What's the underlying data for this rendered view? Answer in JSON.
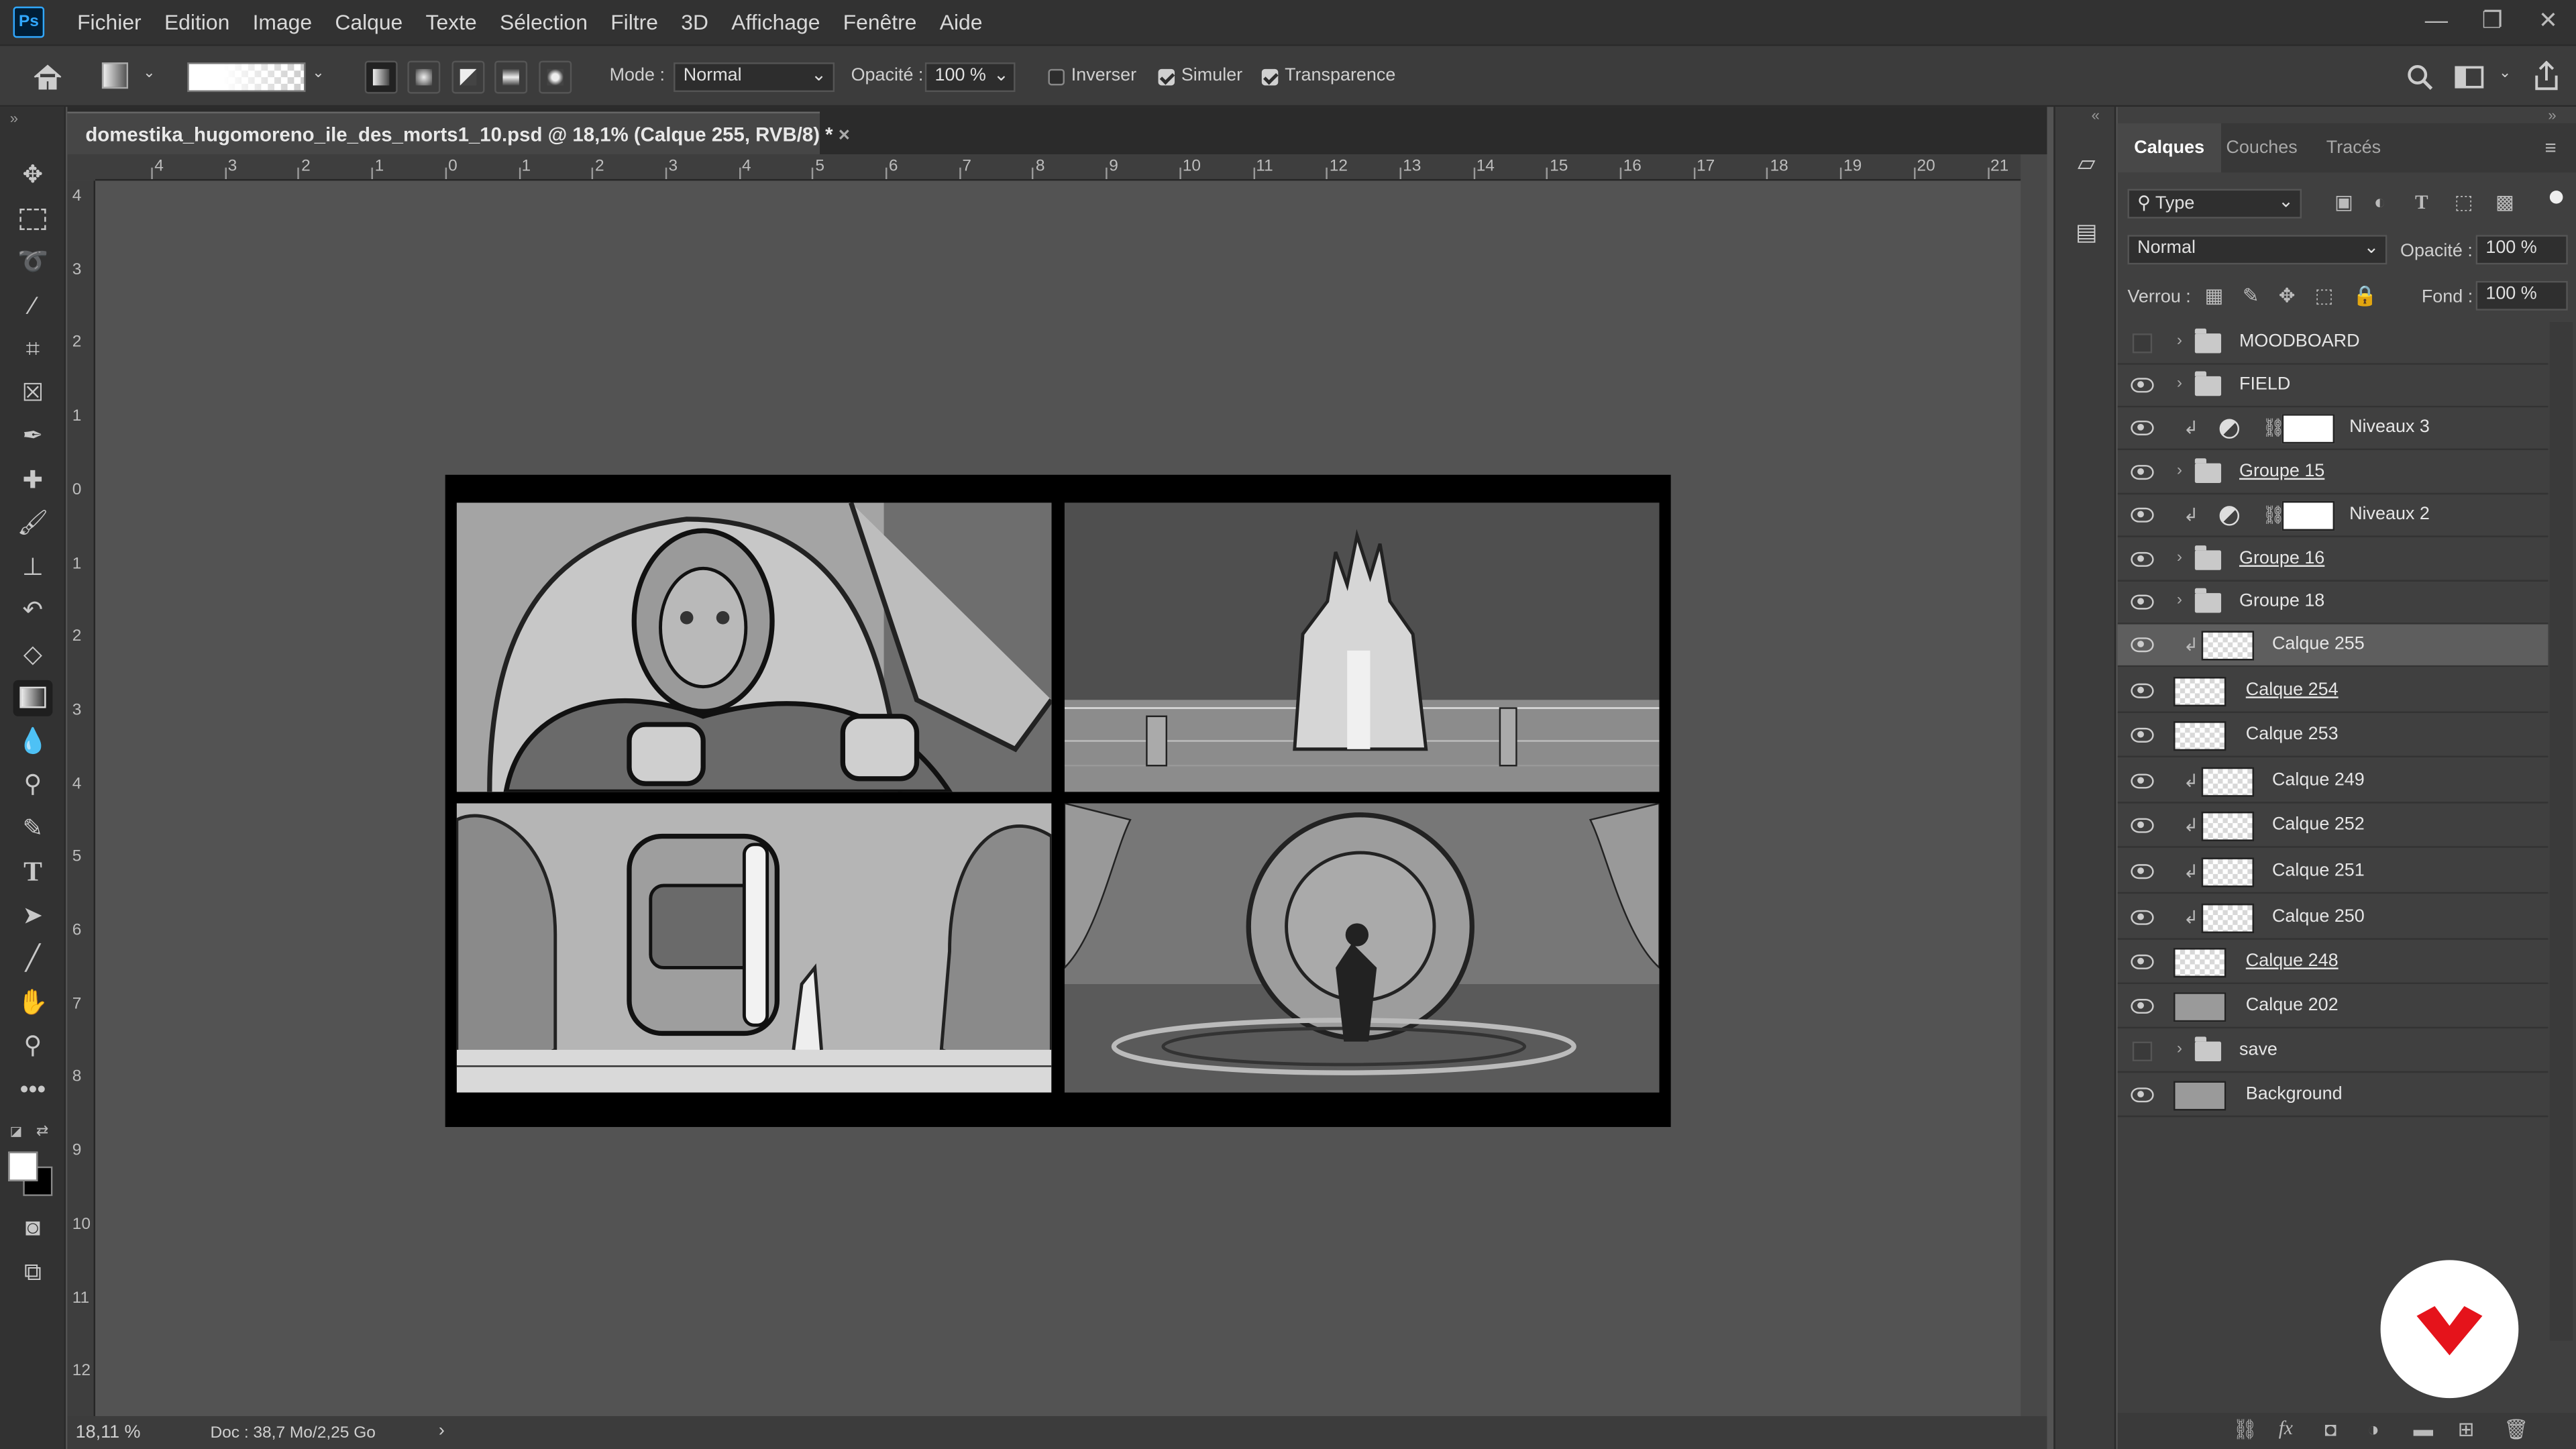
{
  "app": {
    "logo_text": "Ps"
  },
  "menu": [
    "Fichier",
    "Edition",
    "Image",
    "Calque",
    "Texte",
    "Sélection",
    "Filtre",
    "3D",
    "Affichage",
    "Fenêtre",
    "Aide"
  ],
  "options": {
    "mode_label": "Mode :",
    "mode_value": "Normal",
    "opacity_label": "Opacité :",
    "opacity_value": "100 %",
    "inverser": "Inverser",
    "simuler": "Simuler",
    "transparence": "Transparence"
  },
  "document": {
    "tab_title": "domestika_hugomoreno_ile_des_morts1_10.psd @ 18,1% (Calque 255, RVB/8) *",
    "close": "×"
  },
  "ruler_h": [
    "4",
    "3",
    "2",
    "1",
    "0",
    "1",
    "2",
    "3",
    "4",
    "5",
    "6",
    "7",
    "8",
    "9",
    "10",
    "11",
    "12",
    "13",
    "14",
    "15",
    "16",
    "17",
    "18",
    "19",
    "20",
    "21"
  ],
  "ruler_v": [
    "4",
    "3",
    "2",
    "1",
    "0",
    "1",
    "2",
    "3",
    "4",
    "5",
    "6",
    "7",
    "8",
    "9",
    "10",
    "11",
    "12"
  ],
  "status": {
    "zoom": "18,11 %",
    "doc": "Doc : 38,7 Mo/2,25 Go",
    "arrow": "›"
  },
  "layers_panel": {
    "tabs": [
      "Calques",
      "Couches",
      "Tracés"
    ],
    "filter": "Type",
    "blend_mode": "Normal",
    "opacity_label": "Opacité :",
    "opacity_value": "100 %",
    "lock_label": "Verrou :",
    "fill_label": "Fond :",
    "fill_value": "100 %",
    "layers": [
      {
        "name": "MOODBOARD",
        "kind": "group",
        "visible": false
      },
      {
        "name": "FIELD",
        "kind": "group",
        "visible": true
      },
      {
        "name": "Niveaux 3",
        "kind": "adjust",
        "visible": true
      },
      {
        "name": "Groupe 15",
        "kind": "group",
        "visible": true,
        "underline": true
      },
      {
        "name": "Niveaux 2",
        "kind": "adjust",
        "visible": true
      },
      {
        "name": "Groupe 16",
        "kind": "group",
        "visible": true,
        "underline": true
      },
      {
        "name": "Groupe 18",
        "kind": "group",
        "visible": true
      },
      {
        "name": "Calque 255",
        "kind": "clip",
        "visible": true,
        "selected": true
      },
      {
        "name": "Calque 254",
        "kind": "layer",
        "visible": true,
        "underline": true
      },
      {
        "name": "Calque 253",
        "kind": "layer",
        "visible": true
      },
      {
        "name": "Calque 249",
        "kind": "clip",
        "visible": true
      },
      {
        "name": "Calque 252",
        "kind": "clip",
        "visible": true
      },
      {
        "name": "Calque 251",
        "kind": "clip",
        "visible": true
      },
      {
        "name": "Calque 250",
        "kind": "clip",
        "visible": true
      },
      {
        "name": "Calque 248",
        "kind": "layer",
        "visible": true,
        "underline": true
      },
      {
        "name": "Calque 202",
        "kind": "grey",
        "visible": true
      },
      {
        "name": "save",
        "kind": "group",
        "visible": false
      },
      {
        "name": "Background",
        "kind": "grey",
        "visible": true
      }
    ]
  }
}
